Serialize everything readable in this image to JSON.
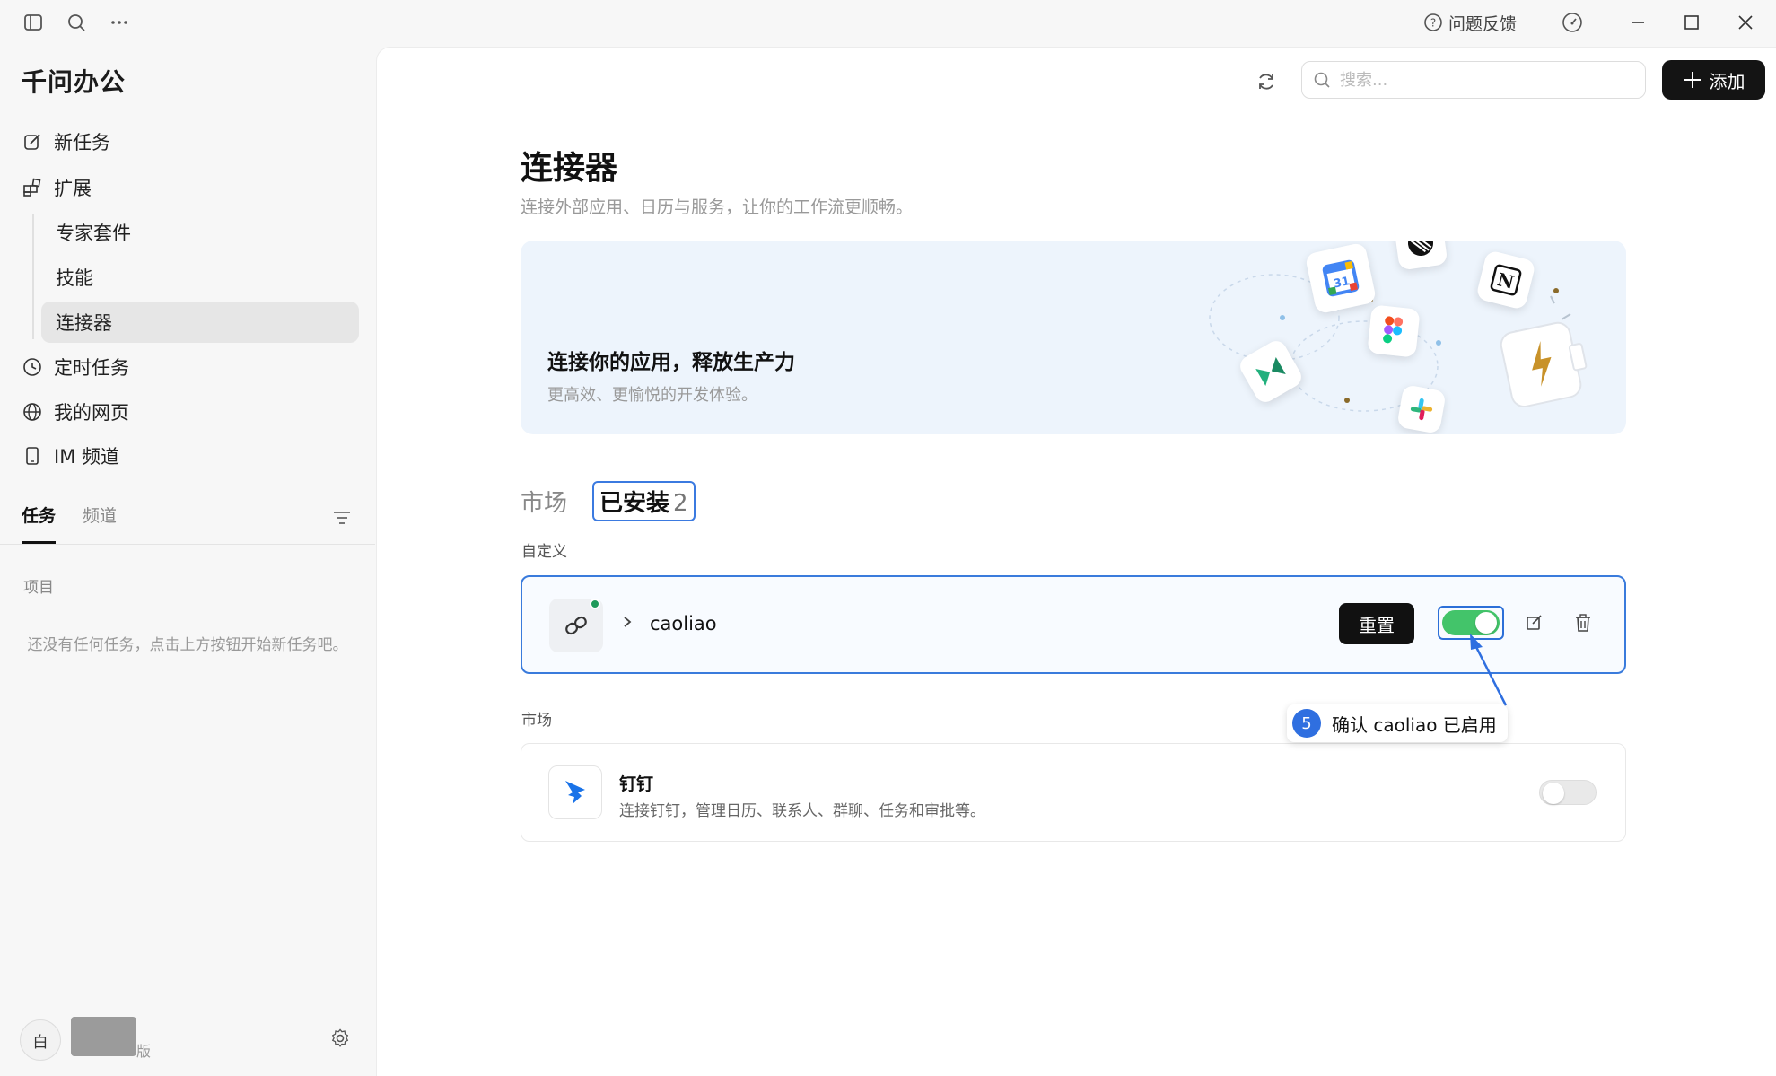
{
  "app": {
    "title": "千问办公"
  },
  "titlebar": {
    "feedback_label": "问题反馈"
  },
  "sidebar": {
    "nav": {
      "new_task": "新任务",
      "extensions": "扩展",
      "extensions_children": [
        "专家套件",
        "技能",
        "连接器"
      ],
      "scheduled": "定时任务",
      "my_pages": "我的网页",
      "im_channel": "IM 频道"
    },
    "tabs": [
      "任务",
      "频道"
    ],
    "project_label": "项目",
    "empty_text": "还没有任何任务，点击上方按钮开始新任务吧。",
    "user": {
      "avatar_text": "白",
      "plan_suffix": "版"
    }
  },
  "toolbar": {
    "search_placeholder": "搜索...",
    "add_label": "添加"
  },
  "page": {
    "title": "连接器",
    "subtitle": "连接外部应用、日历与服务，让你的工作流更顺畅。",
    "banner": {
      "title": "连接你的应用，释放生产力",
      "subtitle": "更高效、更愉悦的开发体验。",
      "calendar_day": "31",
      "notion_letter": "N"
    },
    "tabs": {
      "market": "市场",
      "installed": "已安装",
      "installed_count": "2"
    }
  },
  "custom_section": {
    "label": "自定义",
    "connector": {
      "name": "caoliao",
      "reset_label": "重置",
      "enabled": true
    }
  },
  "market_section": {
    "label": "市场",
    "connector": {
      "name": "钉钉",
      "description": "连接钉钉，管理日历、联系人、群聊、任务和审批等。",
      "enabled": false
    }
  },
  "callout": {
    "step": "5",
    "text": "确认 caoliao 已启用"
  },
  "colors": {
    "accent": "#2f6fe0",
    "toggle_on": "#43c46a",
    "primary_button": "#141414"
  }
}
